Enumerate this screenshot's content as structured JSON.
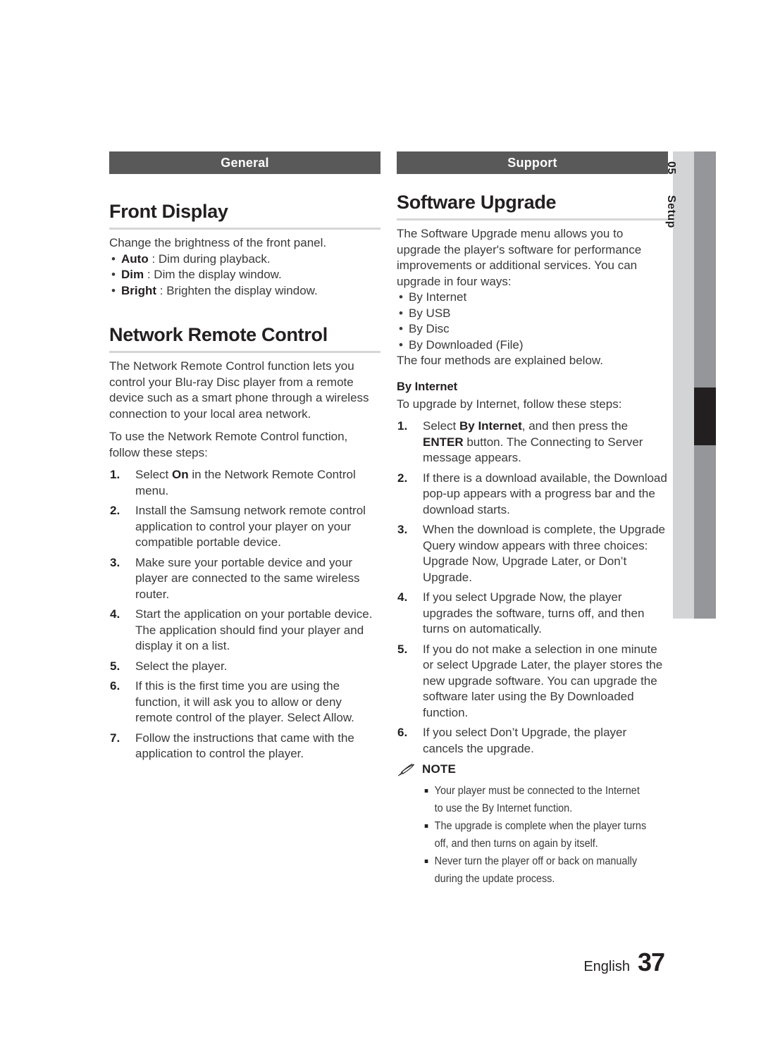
{
  "page": {
    "footer_language": "English",
    "footer_number": "37",
    "banner_color": "#595959",
    "rule_color": "#d6d6d6"
  },
  "side_tab": {
    "number": "05",
    "label": "Setup",
    "light_color": "#d2d4d5",
    "dark_color": "#949699",
    "marker_color": "#231f20"
  },
  "left_column": {
    "banner": "General",
    "section": {
      "heading": "Front Display",
      "intro": "Change the brightness of the front panel.",
      "options": [
        {
          "term": "Auto",
          "sep": " : ",
          "desc": "Dim during playback."
        },
        {
          "term": "Dim",
          "sep": " : ",
          "desc": "Dim the display window."
        },
        {
          "term": "Bright",
          "sep": " : ",
          "desc": "Brighten the display window."
        }
      ]
    },
    "section2": {
      "heading": "Network Remote Control",
      "paragraphs": [
        "The Network Remote Control function lets you control your Blu-ray Disc player from a remote device such as a smart phone through a wireless connection to your local area network.",
        "To use the Network Remote Control function, follow these steps:"
      ],
      "steps": [
        {
          "num": "1.",
          "pre": "Select ",
          "bold": "On",
          "post": " in the Network Remote Control menu."
        },
        {
          "num": "2.",
          "pre": "Install the Samsung network remote control application to control your player on your compatible portable device.",
          "bold": "",
          "post": ""
        },
        {
          "num": "3.",
          "pre": "Make sure your portable device and your player are connected to the same wireless router.",
          "bold": "",
          "post": ""
        },
        {
          "num": "4.",
          "pre": "Start the application on your portable device. The application should find your player and display it on a list.",
          "bold": "",
          "post": ""
        },
        {
          "num": "5.",
          "pre": "Select the player.",
          "bold": "",
          "post": ""
        },
        {
          "num": "6.",
          "pre": "If this is the first time you are using the function, it will ask you to allow or deny remote control of the player. Select Allow.",
          "bold": "",
          "post": ""
        },
        {
          "num": "7.",
          "pre": "Follow the instructions that came with the application to control the player.",
          "bold": "",
          "post": ""
        }
      ]
    }
  },
  "right_column": {
    "banner": "Support",
    "section": {
      "heading": "Software Upgrade",
      "intro": "The Software Upgrade menu allows you to upgrade the player's software for performance improvements or additional services. You can upgrade in four ways:",
      "methods": [
        "By Internet",
        "By USB",
        "By Disc",
        "By Downloaded (File)"
      ],
      "after_methods": "The four methods are explained below.",
      "subheading": "By Internet",
      "sub_intro": "To upgrade by Internet, follow these steps:",
      "steps": [
        {
          "num": "1.",
          "pre": "Select ",
          "bold": "By Internet",
          "mid": ", and then press the ",
          "bold2": "ENTER",
          "post": " button. The Connecting to Server message appears."
        },
        {
          "num": "2.",
          "pre": "If there is a download available, the Download pop-up appears with a progress bar and the download starts.",
          "bold": "",
          "mid": "",
          "bold2": "",
          "post": ""
        },
        {
          "num": "3.",
          "pre": "When the download is complete, the Upgrade Query window appears with three choices: Upgrade Now, Upgrade Later, or Don’t Upgrade.",
          "bold": "",
          "mid": "",
          "bold2": "",
          "post": ""
        },
        {
          "num": "4.",
          "pre": "If you select Upgrade Now, the player upgrades the software, turns off, and then turns on automatically.",
          "bold": "",
          "mid": "",
          "bold2": "",
          "post": ""
        },
        {
          "num": "5.",
          "pre": "If you do not make a selection in one minute or select Upgrade Later, the player stores the new upgrade software. You can upgrade the software later using the By Downloaded function.",
          "bold": "",
          "mid": "",
          "bold2": "",
          "post": ""
        },
        {
          "num": "6.",
          "pre": "If you select Don’t Upgrade, the player cancels the upgrade.",
          "bold": "",
          "mid": "",
          "bold2": "",
          "post": ""
        }
      ]
    },
    "note": {
      "title": "NOTE",
      "items": [
        "Your player must be connected to the Internet to use the By Internet function.",
        "The upgrade is complete when the player turns off, and then turns on again by itself.",
        "Never turn the player off or back on manually during the update process."
      ]
    }
  }
}
